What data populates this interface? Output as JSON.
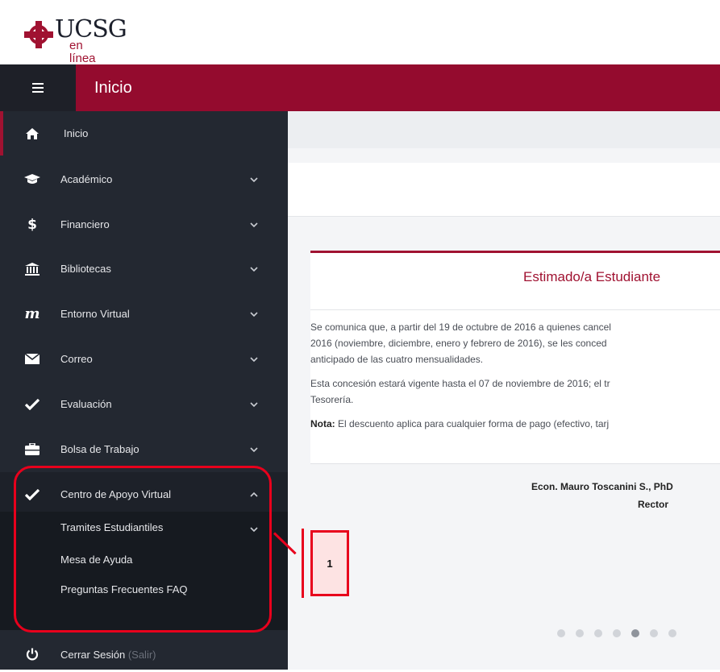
{
  "logo": {
    "brand": "UCSG",
    "tagline": "en línea"
  },
  "header": {
    "title": "Inicio"
  },
  "sidebar": {
    "items": [
      {
        "label": "Inicio",
        "icon": "home-icon"
      },
      {
        "label": "Académico",
        "icon": "graduation-cap-icon"
      },
      {
        "label": "Financiero",
        "icon": "dollar-icon"
      },
      {
        "label": "Bibliotecas",
        "icon": "bank-icon"
      },
      {
        "label": "Entorno Virtual",
        "icon": "moodle-icon"
      },
      {
        "label": "Correo",
        "icon": "envelope-icon"
      },
      {
        "label": "Evaluación",
        "icon": "check-icon"
      },
      {
        "label": "Bolsa de Trabajo",
        "icon": "briefcase-icon"
      },
      {
        "label": "Centro de Apoyo Virtual",
        "icon": "check-icon"
      }
    ],
    "submenu": [
      {
        "label": "Tramites Estudiantiles"
      },
      {
        "label": "Mesa de Ayuda"
      },
      {
        "label": "Preguntas Frecuentes FAQ"
      }
    ],
    "logout": {
      "label": "Cerrar Sesión",
      "hint": "(Salir)"
    }
  },
  "notice": {
    "title": "Estimado/a Estudiante",
    "lines": [
      "Se comunica que, a partir del 19 de octubre de 2016 a quienes cancel",
      "2016 (noviembre, diciembre, enero y febrero de 2016), se les conced",
      "anticipado de las cuatro mensualidades.",
      "Esta concesión estará vigente hasta el 07 de noviembre de 2016; el tr",
      "Tesorería."
    ],
    "note_label": "Nota:",
    "note_text": " El descuento aplica para cualquier forma de pago (efectivo, tarj",
    "signature_name": "Econ. Mauro Toscanini S., PhD",
    "signature_role": "Rector"
  },
  "carousel": {
    "dot_count": 7,
    "active_index": 4
  },
  "annotation": {
    "label": "1",
    "color": "#e8001c"
  },
  "colors": {
    "brand": "#940b2e",
    "sidebar": "#232831"
  }
}
